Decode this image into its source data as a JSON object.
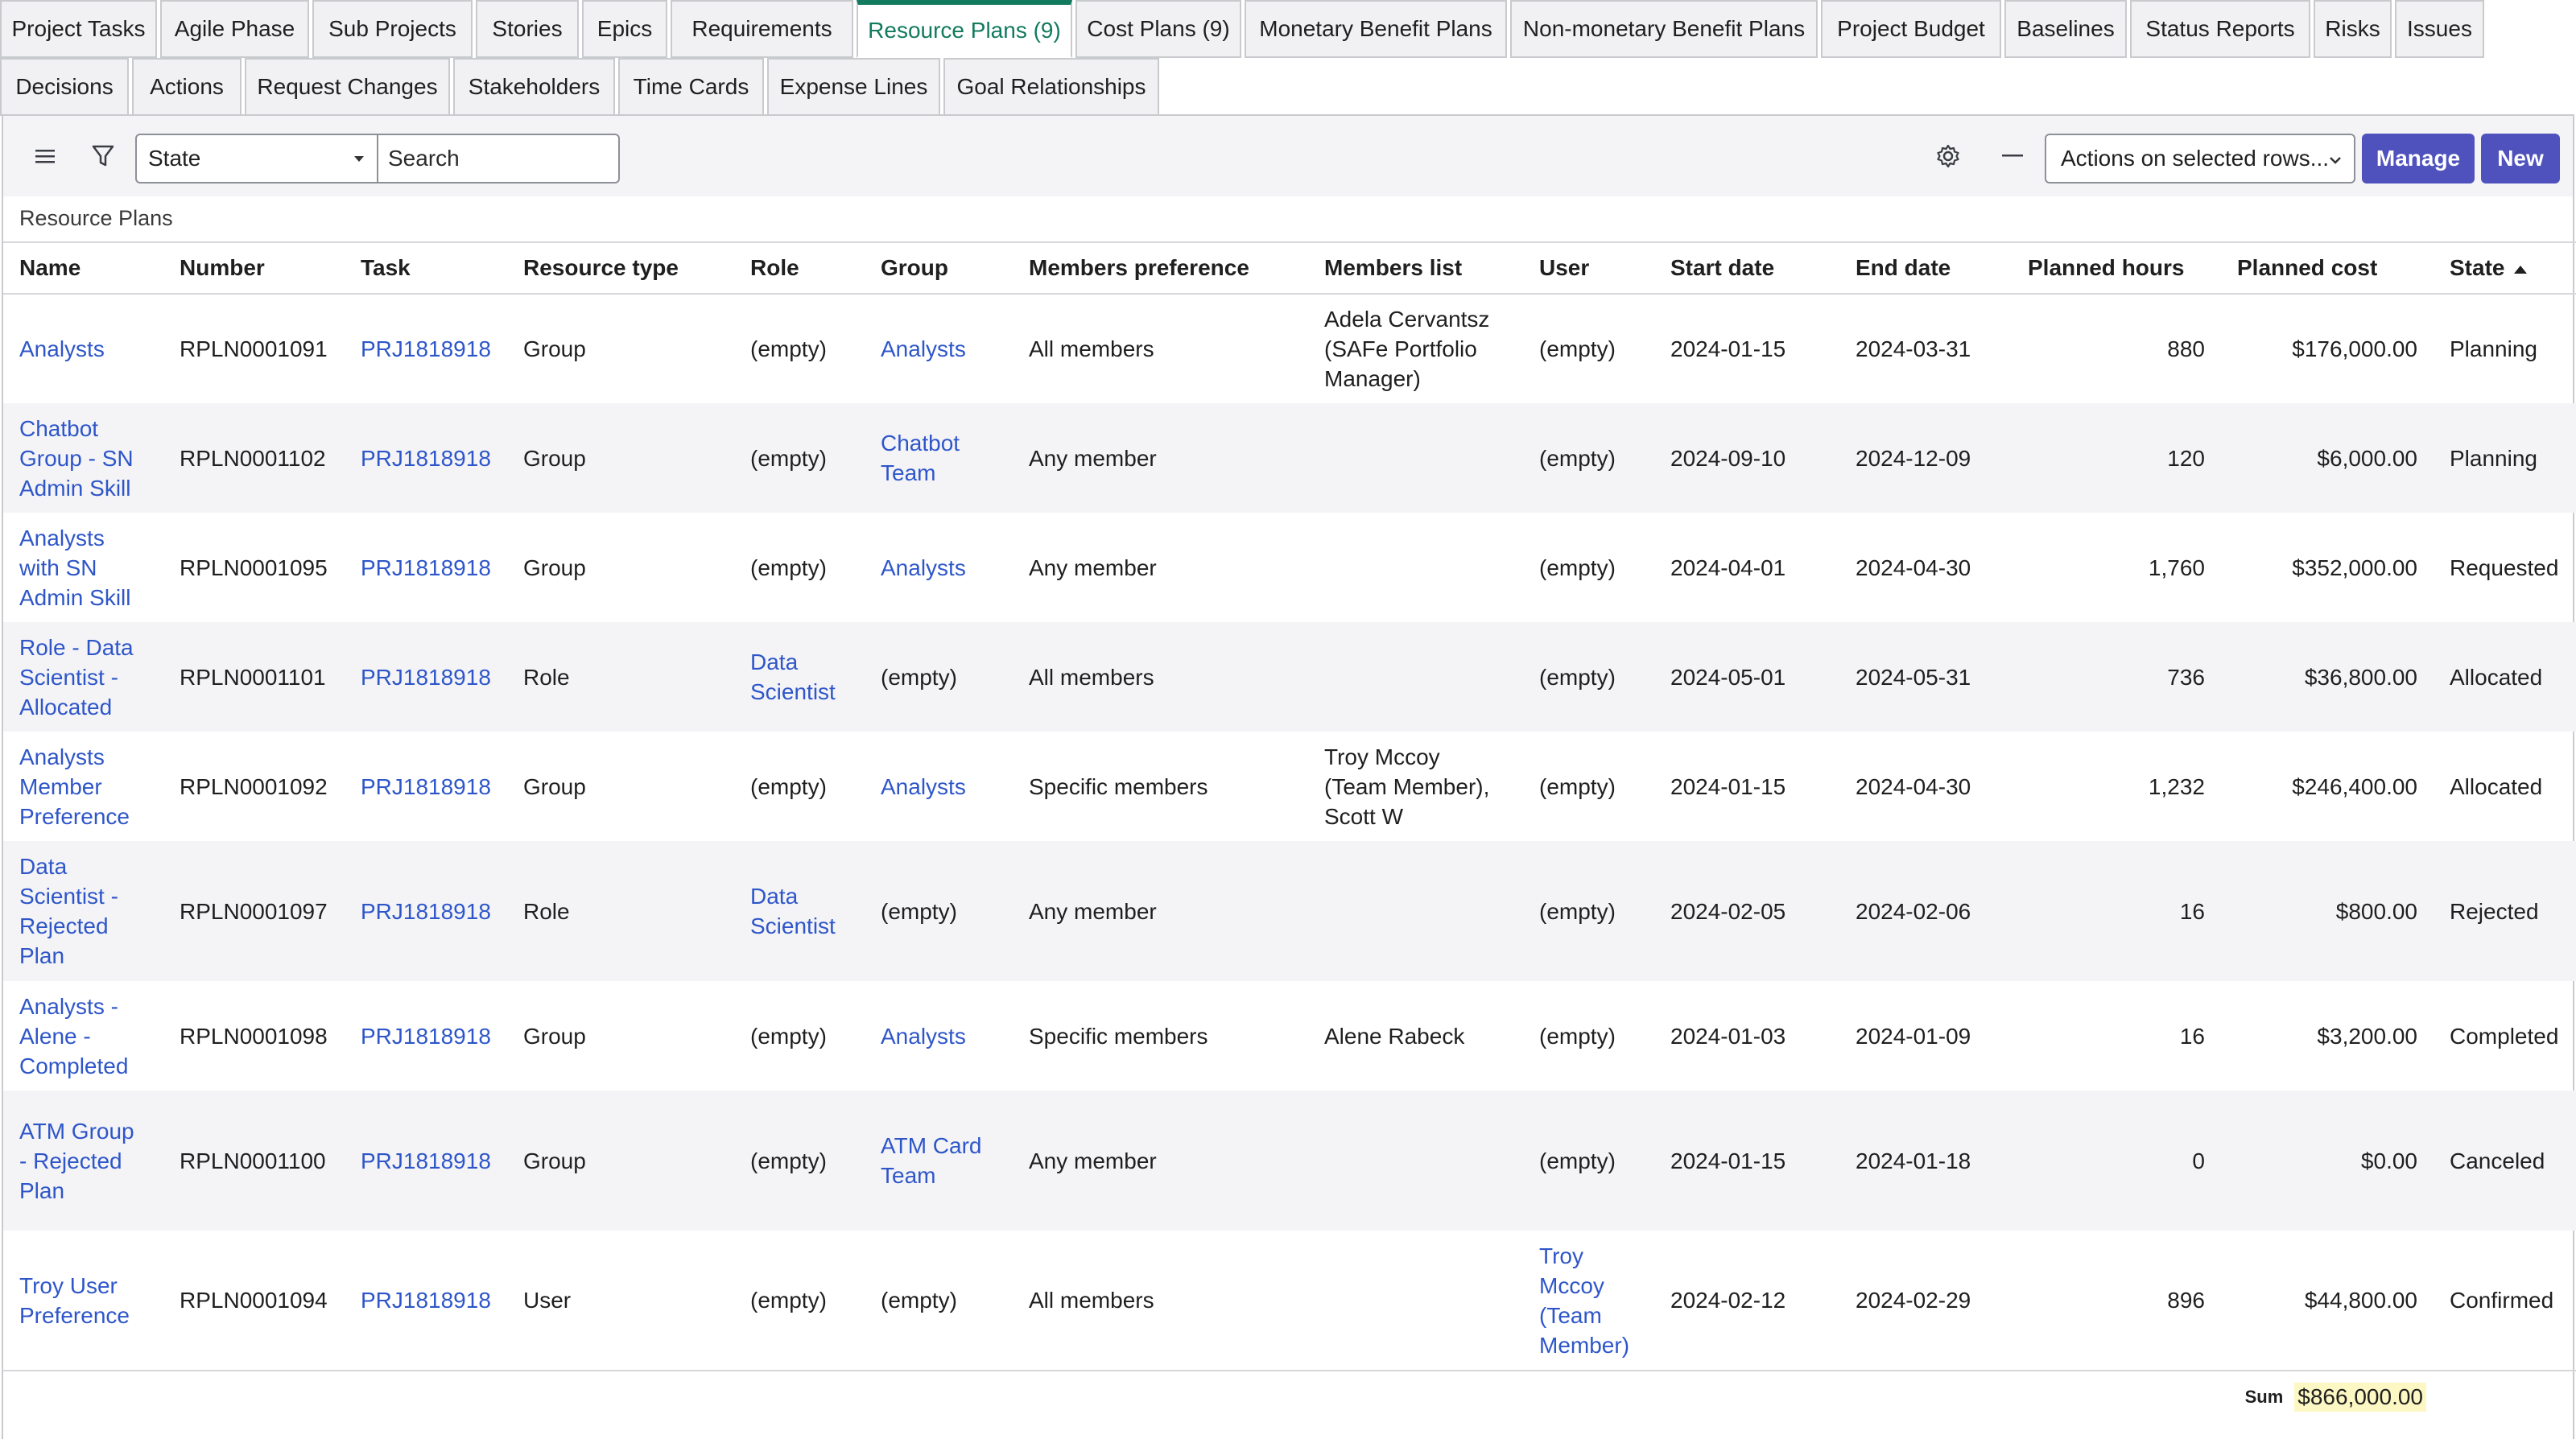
{
  "tabs_row1": [
    {
      "label": "Project Tasks",
      "active": false
    },
    {
      "label": "Agile Phase",
      "active": false
    },
    {
      "label": "Sub Projects",
      "active": false
    },
    {
      "label": "Stories",
      "active": false
    },
    {
      "label": "Epics",
      "active": false
    },
    {
      "label": "Requirements",
      "active": false
    },
    {
      "label": "Resource Plans (9)",
      "active": true
    },
    {
      "label": "Cost Plans (9)",
      "active": false
    },
    {
      "label": "Monetary Benefit Plans",
      "active": false
    },
    {
      "label": "Non-monetary Benefit Plans",
      "active": false
    },
    {
      "label": "Project Budget",
      "active": false
    },
    {
      "label": "Baselines",
      "active": false
    },
    {
      "label": "Status Reports",
      "active": false
    },
    {
      "label": "Risks",
      "active": false
    },
    {
      "label": "Issues",
      "active": false
    }
  ],
  "tabs_row2": [
    {
      "label": "Decisions"
    },
    {
      "label": "Actions"
    },
    {
      "label": "Request Changes"
    },
    {
      "label": "Stakeholders"
    },
    {
      "label": "Time Cards"
    },
    {
      "label": "Expense Lines"
    },
    {
      "label": "Goal Relationships"
    }
  ],
  "toolbar": {
    "menu_icon": "hamburger-menu-icon",
    "filter_icon": "filter-icon",
    "state_select_value": "State",
    "search_placeholder": "Search",
    "settings_icon": "gear-icon",
    "collapse_icon": "minus-icon",
    "actions_select_value": "Actions on selected rows...",
    "manage_label": "Manage",
    "new_label": "New",
    "accent_color": "#4f52bd"
  },
  "list_caption": "Resource Plans",
  "columns": [
    "Name",
    "Number",
    "Task",
    "Resource type",
    "Role",
    "Group",
    "Members preference",
    "Members list",
    "User",
    "Start date",
    "End date",
    "Planned hours",
    "Planned cost",
    "State"
  ],
  "rows": [
    {
      "name": "Analysts",
      "number": "RPLN0001091",
      "task": "PRJ1818918",
      "resource_type": "Group",
      "role": "(empty)",
      "group": "Analysts",
      "members_preference": "All members",
      "members_list": "Adela Cervantsz (SAFe Portfolio Manager)",
      "user": "(empty)",
      "start_date": "2024-01-15",
      "end_date": "2024-03-31",
      "planned_hours": "880",
      "planned_cost": "$176,000.00",
      "state": "Planning"
    },
    {
      "name": "Chatbot Group - SN Admin Skill",
      "number": "RPLN0001102",
      "task": "PRJ1818918",
      "resource_type": "Group",
      "role": "(empty)",
      "group": "Chatbot Team",
      "members_preference": "Any member",
      "members_list": "",
      "user": "(empty)",
      "start_date": "2024-09-10",
      "end_date": "2024-12-09",
      "planned_hours": "120",
      "planned_cost": "$6,000.00",
      "state": "Planning"
    },
    {
      "name": "Analysts with SN Admin Skill",
      "number": "RPLN0001095",
      "task": "PRJ1818918",
      "resource_type": "Group",
      "role": "(empty)",
      "group": "Analysts",
      "members_preference": "Any member",
      "members_list": "",
      "user": "(empty)",
      "start_date": "2024-04-01",
      "end_date": "2024-04-30",
      "planned_hours": "1,760",
      "planned_cost": "$352,000.00",
      "state": "Requested"
    },
    {
      "name": "Role - Data Scientist - Allocated",
      "number": "RPLN0001101",
      "task": "PRJ1818918",
      "resource_type": "Role",
      "role": "Data Scientist",
      "group": "(empty)",
      "members_preference": "All members",
      "members_list": "",
      "user": "(empty)",
      "start_date": "2024-05-01",
      "end_date": "2024-05-31",
      "planned_hours": "736",
      "planned_cost": "$36,800.00",
      "state": "Allocated"
    },
    {
      "name": "Analysts Member Preference",
      "number": "RPLN0001092",
      "task": "PRJ1818918",
      "resource_type": "Group",
      "role": "(empty)",
      "group": "Analysts",
      "members_preference": "Specific members",
      "members_list": "Troy Mccoy (Team Member), Scott W",
      "user": "(empty)",
      "start_date": "2024-01-15",
      "end_date": "2024-04-30",
      "planned_hours": "1,232",
      "planned_cost": "$246,400.00",
      "state": "Allocated"
    },
    {
      "name": "Data Scientist - Rejected Plan",
      "number": "RPLN0001097",
      "task": "PRJ1818918",
      "resource_type": "Role",
      "role": "Data Scientist",
      "group": "(empty)",
      "members_preference": "Any member",
      "members_list": "",
      "user": "(empty)",
      "start_date": "2024-02-05",
      "end_date": "2024-02-06",
      "planned_hours": "16",
      "planned_cost": "$800.00",
      "state": "Rejected"
    },
    {
      "name": "Analysts - Alene - Completed",
      "number": "RPLN0001098",
      "task": "PRJ1818918",
      "resource_type": "Group",
      "role": "(empty)",
      "group": "Analysts",
      "members_preference": "Specific members",
      "members_list": "Alene Rabeck",
      "user": "(empty)",
      "start_date": "2024-01-03",
      "end_date": "2024-01-09",
      "planned_hours": "16",
      "planned_cost": "$3,200.00",
      "state": "Completed"
    },
    {
      "name": "ATM Group - Rejected Plan",
      "number": "RPLN0001100",
      "task": "PRJ1818918",
      "resource_type": "Group",
      "role": "(empty)",
      "group": "ATM Card Team",
      "members_preference": "Any member",
      "members_list": "",
      "user": "(empty)",
      "start_date": "2024-01-15",
      "end_date": "2024-01-18",
      "planned_hours": "0",
      "planned_cost": "$0.00",
      "state": "Canceled"
    },
    {
      "name": "Troy User Preference",
      "number": "RPLN0001094",
      "task": "PRJ1818918",
      "resource_type": "User",
      "role": "(empty)",
      "group": "(empty)",
      "members_preference": "All members",
      "members_list": "",
      "user": "Troy Mccoy (Team Member)",
      "start_date": "2024-02-12",
      "end_date": "2024-02-29",
      "planned_hours": "896",
      "planned_cost": "$44,800.00",
      "state": "Confirmed"
    }
  ],
  "sum": {
    "label": "Sum",
    "value": "$866,000.00"
  },
  "colors": {
    "link": "#2e56c9",
    "active_tab": "#127a5e",
    "sum_highlight": "#fdf7c3"
  }
}
